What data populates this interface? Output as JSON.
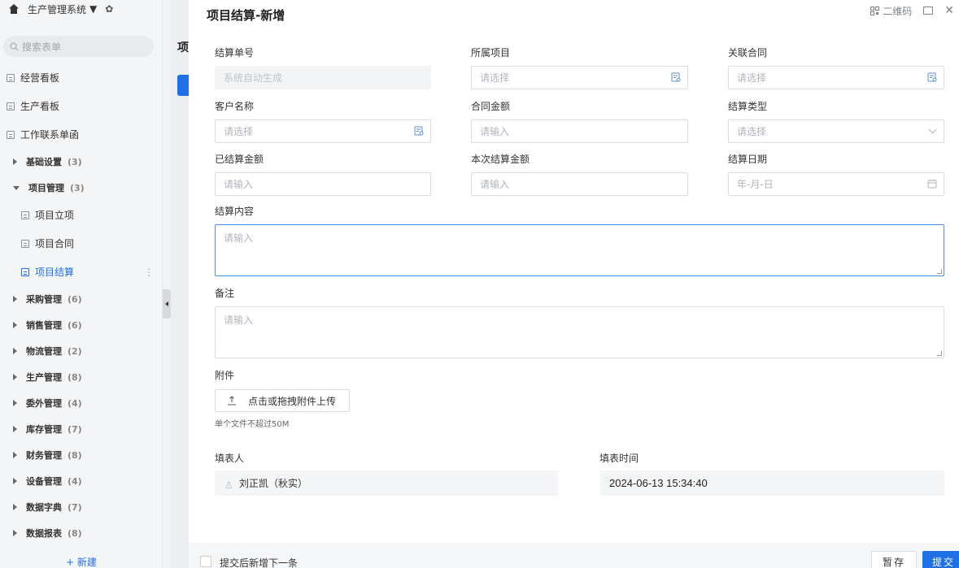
{
  "sidebar": {
    "system_name": "生产管理系统",
    "search_placeholder": "搜索表单",
    "top_items": [
      {
        "label": "经营看板"
      },
      {
        "label": "生产看板"
      },
      {
        "label": "工作联系单函"
      }
    ],
    "groups": [
      {
        "label": "基础设置",
        "count": "(3)",
        "expanded": false
      },
      {
        "label": "项目管理",
        "count": "(3)",
        "expanded": true
      },
      {
        "label": "采购管理",
        "count": "(6)"
      },
      {
        "label": "销售管理",
        "count": "(6)"
      },
      {
        "label": "物流管理",
        "count": "(2)"
      },
      {
        "label": "生产管理",
        "count": "(8)"
      },
      {
        "label": "委外管理",
        "count": "(4)"
      },
      {
        "label": "库存管理",
        "count": "(7)"
      },
      {
        "label": "财务管理",
        "count": "(8)"
      },
      {
        "label": "设备管理",
        "count": "(4)"
      },
      {
        "label": "数据字典",
        "count": "(7)"
      },
      {
        "label": "数据报表",
        "count": "(8)"
      }
    ],
    "project_items": [
      {
        "label": "项目立项"
      },
      {
        "label": "项目合同"
      },
      {
        "label": "项目结算"
      }
    ],
    "new_label": "+ 新建"
  },
  "underlay": {
    "title": "项"
  },
  "modal": {
    "title": "项目结算-新增",
    "qr_label": "二维码",
    "fields": {
      "settle_no": {
        "label": "结算单号",
        "placeholder": "系统自动生成"
      },
      "project": {
        "label": "所属项目",
        "placeholder": "请选择"
      },
      "contract": {
        "label": "关联合同",
        "placeholder": "请选择"
      },
      "customer": {
        "label": "客户名称",
        "placeholder": "请选择"
      },
      "contract_amount": {
        "label": "合同金额",
        "placeholder": "请输入"
      },
      "settle_type": {
        "label": "结算类型",
        "placeholder": "请选择"
      },
      "settled_amount": {
        "label": "已结算金额",
        "placeholder": "请输入"
      },
      "current_amount": {
        "label": "本次结算金额",
        "placeholder": "请输入"
      },
      "settle_date": {
        "label": "结算日期",
        "placeholder": "年-月-日"
      },
      "content": {
        "label": "结算内容",
        "placeholder": "请输入"
      },
      "remark": {
        "label": "备注",
        "placeholder": "请输入"
      }
    },
    "attachment": {
      "label": "附件",
      "button": "点击或拖拽附件上传",
      "hint": "单个文件不超过50M"
    },
    "filler": {
      "label": "填表人",
      "value": "刘正凯（秋实）"
    },
    "fill_time": {
      "label": "填表时间",
      "value": "2024-06-13 15:34:40"
    },
    "footer": {
      "checkbox_label": "提交后新增下一条",
      "save_label": "暂存",
      "submit_label": "提交"
    }
  }
}
